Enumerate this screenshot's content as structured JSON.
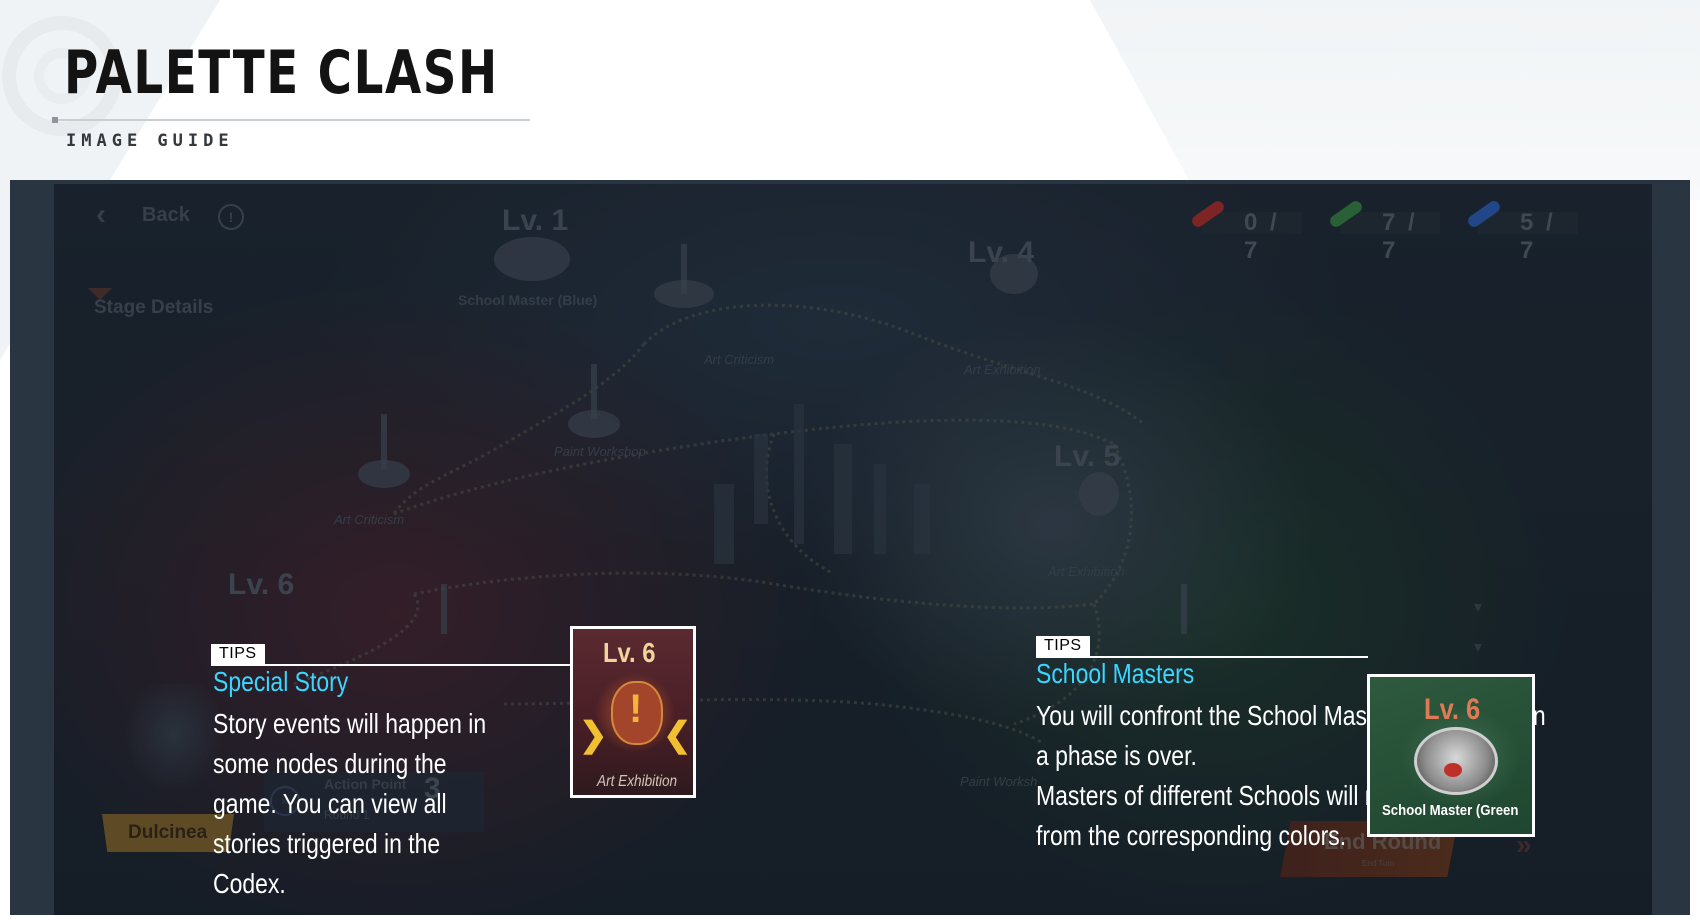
{
  "page": {
    "title": "PALETTE CLASH",
    "subtitle": "IMAGE GUIDE"
  },
  "game": {
    "back_label": "Back",
    "stage_details_label": "Stage Details",
    "counters": [
      {
        "color": "#b8302a",
        "value": "0 / 7"
      },
      {
        "color": "#3a8a44",
        "value": "7 / 7"
      },
      {
        "color": "#2f64c4",
        "value": "5 / 7"
      }
    ],
    "levels": {
      "lv1": "Lv. 1",
      "lv4": "Lv. 4",
      "lv5": "Lv. 5",
      "lv6": "Lv. 6"
    },
    "map_labels": {
      "school_master_blue": "School Master (Blue)",
      "art_criticism_1": "Art Criticism",
      "art_criticism_2": "Art Criticism",
      "art_exhibition_1": "Art Exhibition",
      "art_exhibition_2": "Art Exhibition",
      "paint_workshop_1": "Paint Workshop",
      "paint_workshop_2": "Paint Worksh"
    },
    "character_name": "Dulcinea",
    "action_point_label": "Action Point",
    "action_point_value": "3",
    "round_label": "Round 1",
    "end_round_label": "End Round",
    "end_round_sub": "End Turn"
  },
  "tips": {
    "special_story": {
      "tag": "TIPS",
      "title": "Special Story",
      "body": "Story events will happen in some nodes during the game. You can view all stories triggered in the Codex.",
      "inset_level": "Lv. 6",
      "inset_caption": "Art Exhibition"
    },
    "school_masters": {
      "tag": "TIPS",
      "title": "School Masters",
      "body_1": "You will confront the School Masters directly when a phase is over.",
      "body_2": "Masters of different Schools will receive bonuses from the corresponding colors.",
      "inset_level": "Lv. 6",
      "inset_caption": "School Master (Green"
    }
  }
}
